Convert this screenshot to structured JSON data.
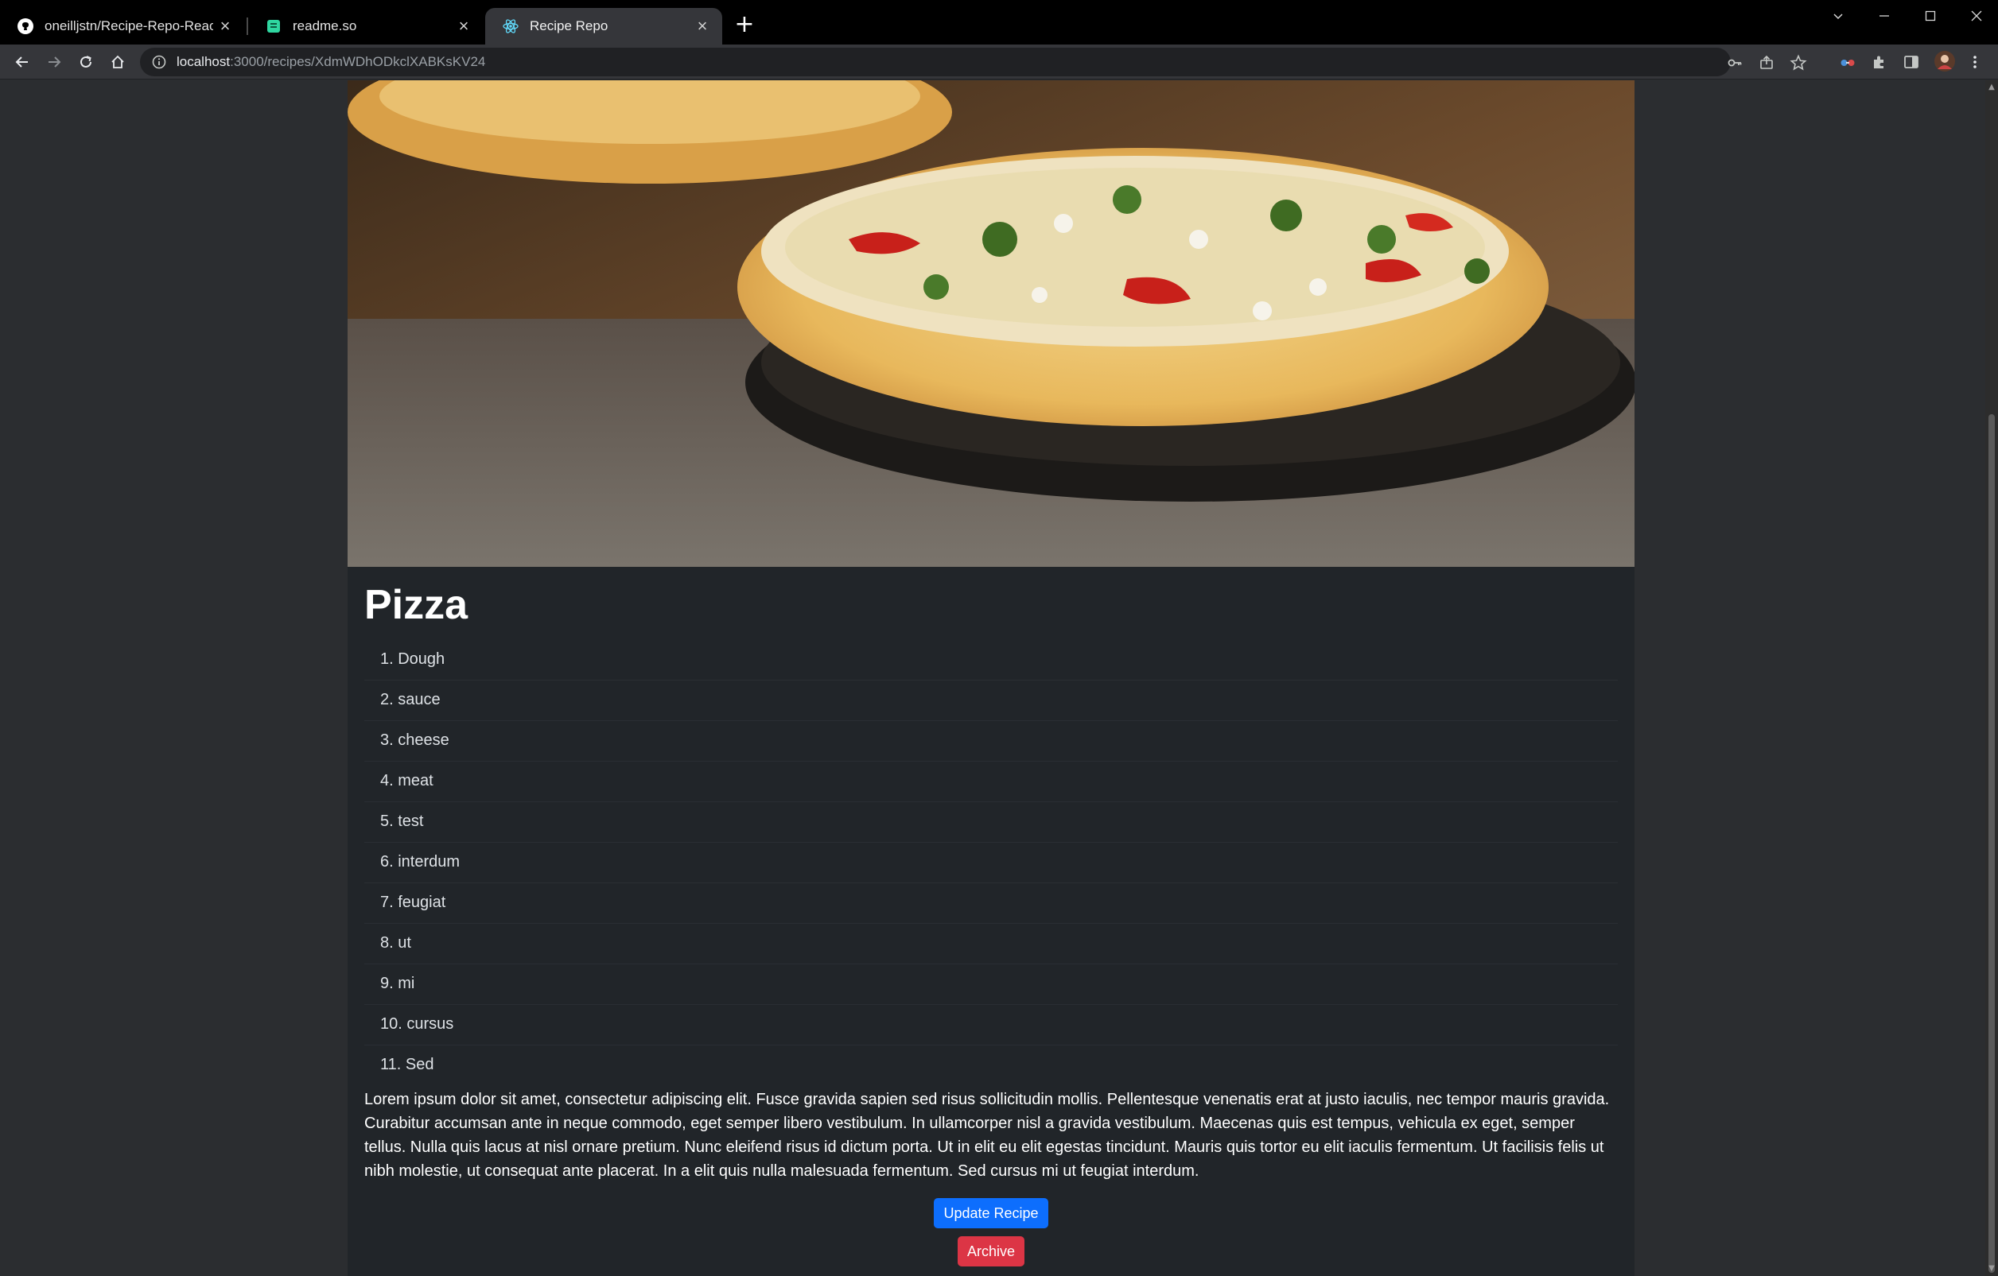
{
  "browser": {
    "tabs": [
      {
        "title": "oneilljstn/Recipe-Repo-React",
        "icon": "github-icon",
        "active": false
      },
      {
        "title": "readme.so",
        "icon": "readme-icon",
        "active": false
      },
      {
        "title": "Recipe Repo",
        "icon": "react-icon",
        "active": true
      }
    ],
    "url_host": "localhost",
    "url_path": ":3000/recipes/XdmWDhODkclXABKsKV24"
  },
  "recipe": {
    "title": "Pizza",
    "ingredients": [
      "1. Dough",
      "2. sauce",
      "3. cheese",
      "4. meat",
      "5. test",
      "6. interdum",
      "7. feugiat",
      "8. ut",
      "9. mi",
      "10. cursus",
      "11. Sed"
    ],
    "description": "Lorem ipsum dolor sit amet, consectetur adipiscing elit. Fusce gravida sapien sed risus sollicitudin mollis. Pellentesque venenatis erat at justo iaculis, nec tempor mauris gravida. Curabitur accumsan ante in neque commodo, eget semper libero vestibulum. In ullamcorper nisl a gravida vestibulum. Maecenas quis est tempus, vehicula ex eget, semper tellus. Nulla quis lacus at nisl ornare pretium. Nunc eleifend risus id dictum porta. Ut in elit eu elit egestas tincidunt. Mauris quis tortor eu elit iaculis fermentum. Ut facilisis felis ut nibh molestie, ut consequat ante placerat. In a elit quis nulla malesuada fermentum. Sed cursus mi ut feugiat interdum.",
    "update_label": "Update Recipe",
    "archive_label": "Archive"
  },
  "colors": {
    "primary": "#0d6efd",
    "danger": "#dc3545",
    "card_bg": "#212529",
    "page_bg": "#2b2d30"
  }
}
